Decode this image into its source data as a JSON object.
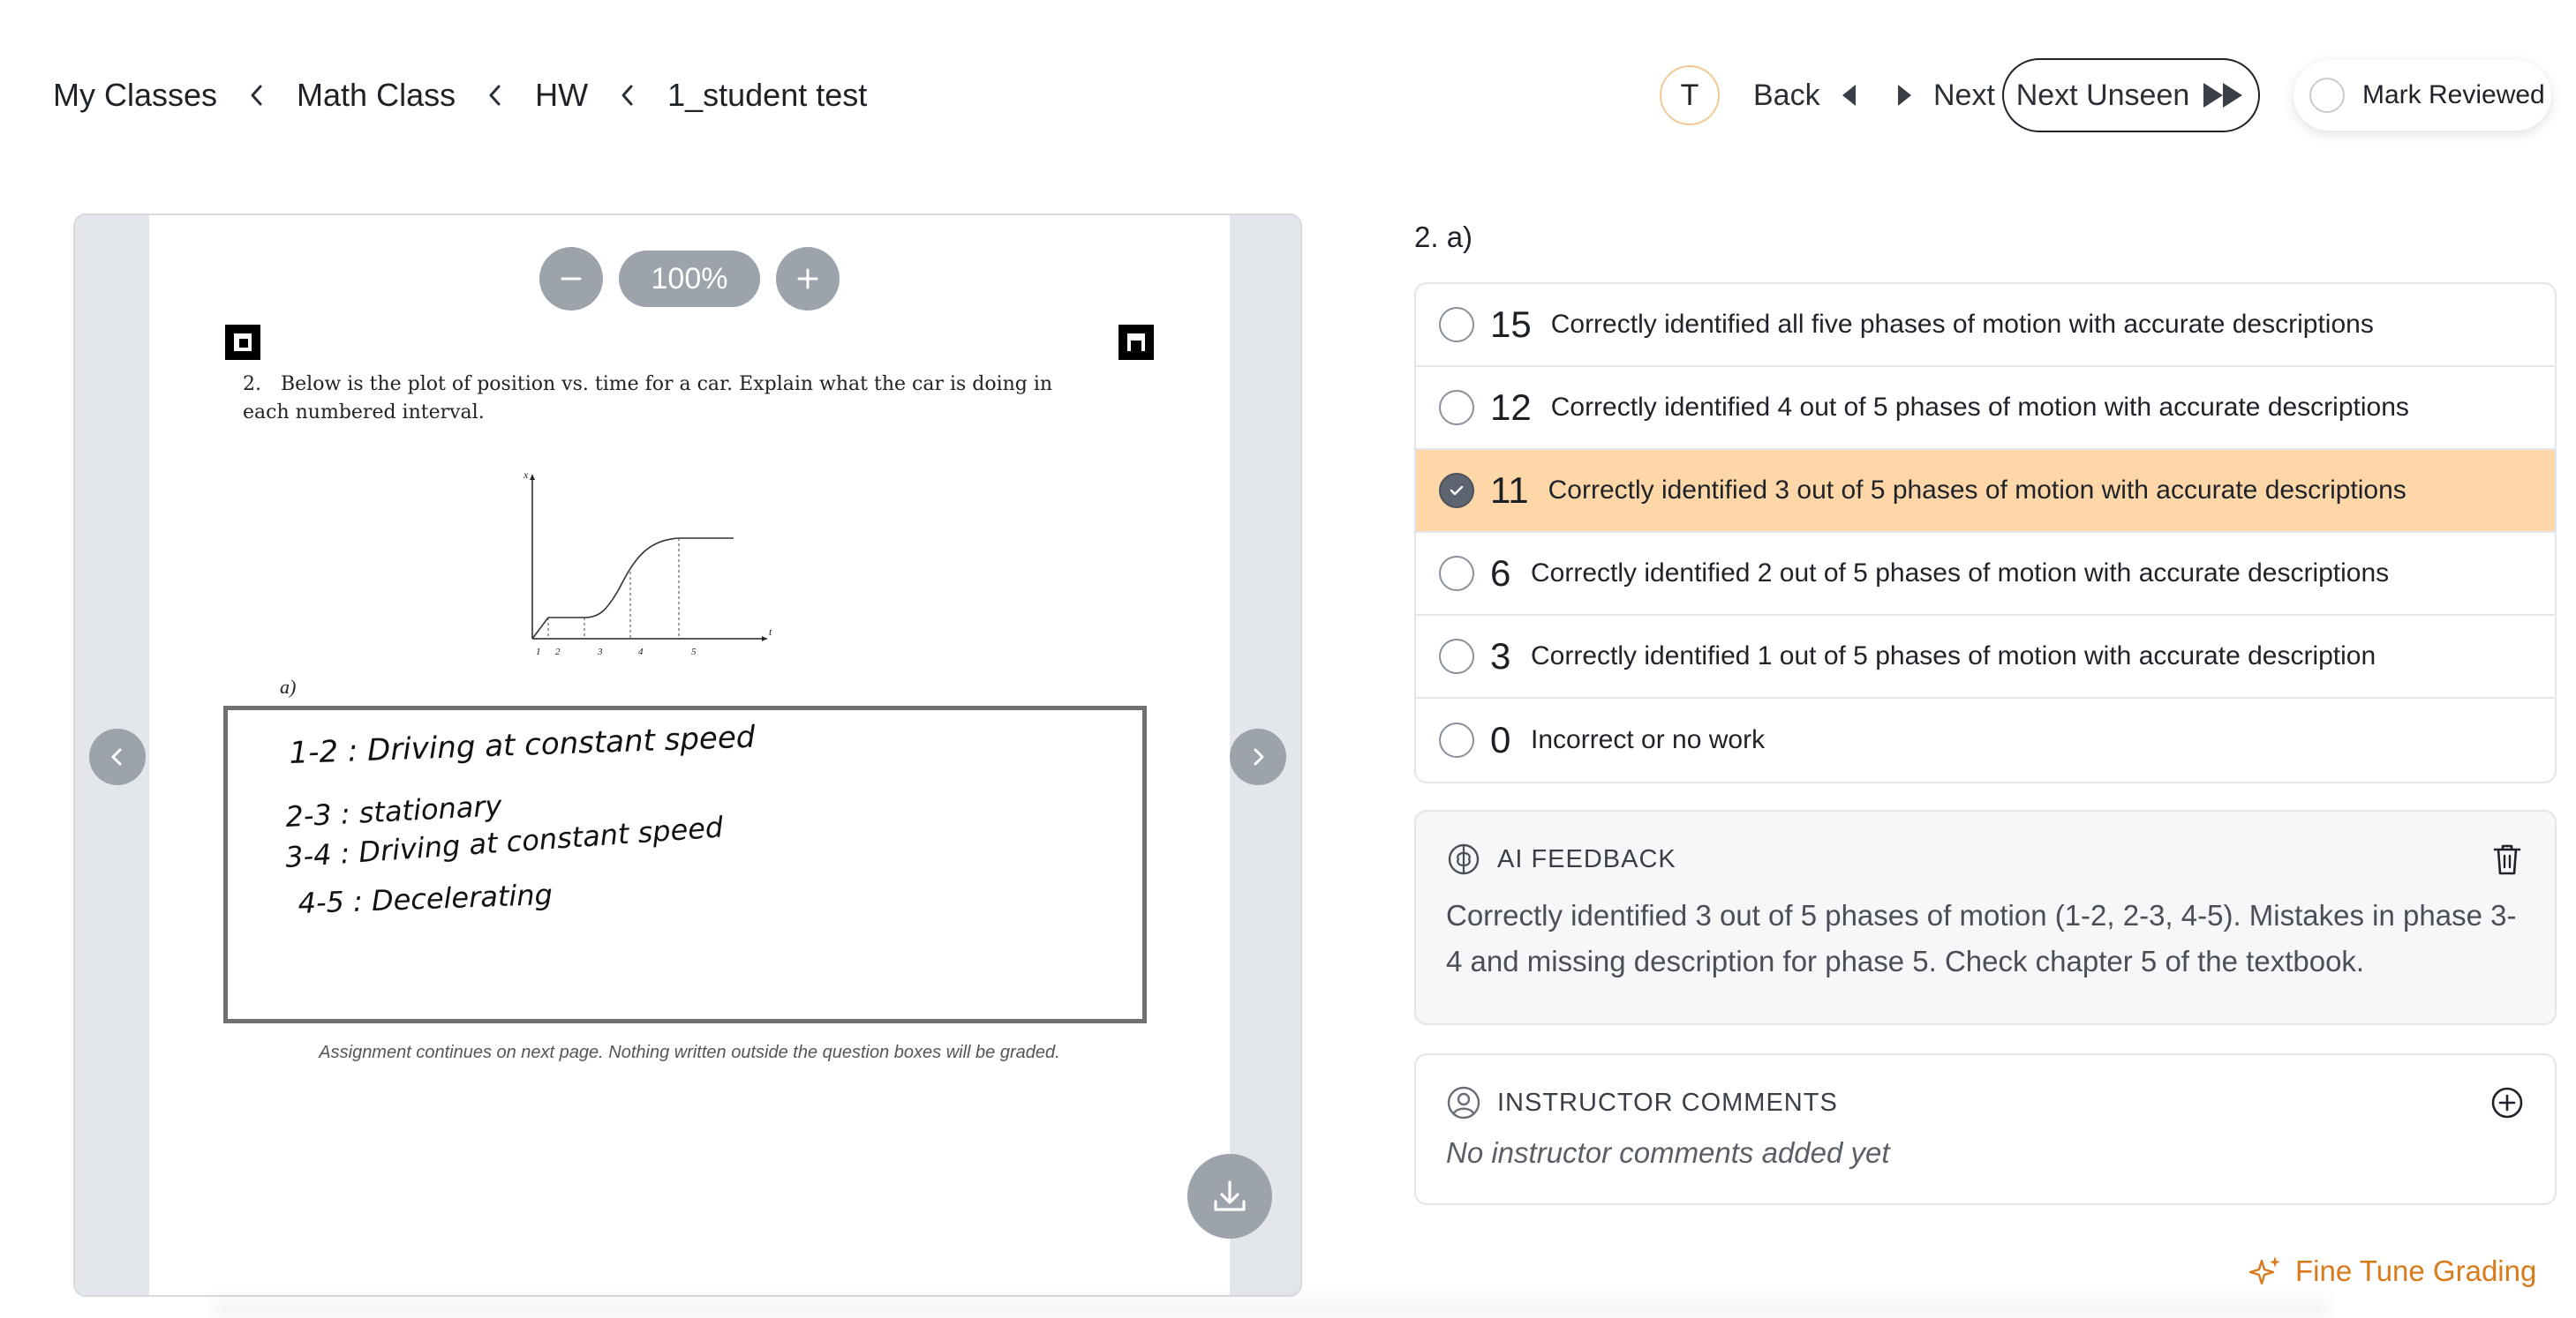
{
  "breadcrumb": {
    "items": [
      "My Classes",
      "Math Class",
      "HW",
      "1_student test"
    ]
  },
  "nav": {
    "avatar_initial": "T",
    "back_label": "Back",
    "next_label": "Next",
    "next_unseen_label": "Next Unseen",
    "mark_reviewed_label": "Mark Reviewed"
  },
  "viewer": {
    "zoom_level": "100%",
    "question_number": "2.",
    "question_text": "Below is the plot of position vs. time for a car. Explain what the car is doing in each numbered interval.",
    "graph": {
      "y_axis_label": "x",
      "x_axis_label": "t",
      "tick_labels": [
        "1",
        "2",
        "3",
        "4",
        "5"
      ]
    },
    "part_label": "a)",
    "handwritten_answer": [
      "1-2 : Driving at constant speed",
      "2-3 : stationary",
      "3-4 : Driving at constant speed",
      "4-5 : Decelerating"
    ],
    "footer_note": "Assignment continues on next page. Nothing written outside the question boxes will be graded."
  },
  "rubric": {
    "question_label": "2. a)",
    "options": [
      {
        "points": "15",
        "description": "Correctly identified all five phases of motion with accurate descriptions",
        "selected": false
      },
      {
        "points": "12",
        "description": "Correctly identified 4 out of 5 phases of motion with accurate descriptions",
        "selected": false
      },
      {
        "points": "11",
        "description": "Correctly identified 3 out of 5 phases of motion with accurate descriptions",
        "selected": true
      },
      {
        "points": "6",
        "description": "Correctly identified 2 out of 5 phases of motion with accurate descriptions",
        "selected": false
      },
      {
        "points": "3",
        "description": "Correctly identified 1 out of 5 phases of motion with accurate description",
        "selected": false
      },
      {
        "points": "0",
        "description": "Incorrect or no work",
        "selected": false
      }
    ],
    "selected_color": "#fdd7a8"
  },
  "ai_feedback": {
    "title": "AI FEEDBACK",
    "text": "Correctly identified 3 out of 5 phases of motion (1-2, 2-3, 4-5). Mistakes in phase 3-4 and missing description for phase 5. Check chapter 5 of the textbook."
  },
  "instructor_comments": {
    "title": "INSTRUCTOR COMMENTS",
    "empty_text": "No instructor comments added yet"
  },
  "fine_tune": {
    "label": "Fine Tune Grading",
    "color": "#d97a1c"
  },
  "icons": [
    "chevron-left-icon",
    "triangle-left-icon",
    "triangle-right-icon",
    "fast-forward-icon",
    "minus-icon",
    "plus-icon",
    "arrow-left-icon",
    "arrow-right-icon",
    "download-icon",
    "check-icon",
    "brain-icon",
    "trash-icon",
    "user-circle-icon",
    "plus-circle-icon",
    "sparkles-icon"
  ]
}
